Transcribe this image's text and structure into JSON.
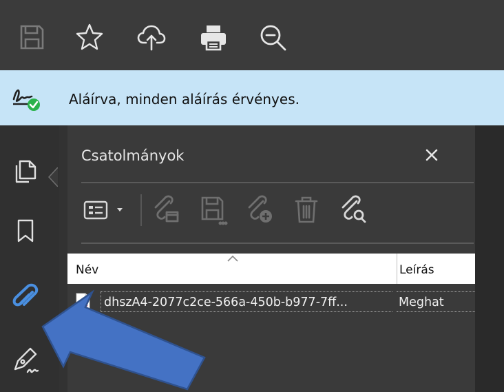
{
  "toolbar": {
    "icons": [
      "save-icon",
      "star-icon",
      "cloud-upload-icon",
      "print-icon",
      "zoom-out-icon"
    ],
    "background": "#3b3b3b"
  },
  "signature_banner": {
    "text": "Aláírva, minden aláírás érvényes.",
    "icon": "signature-valid-icon",
    "background": "#c6e4f7",
    "status_color": "#2bb24c"
  },
  "left_rail": {
    "icons": [
      "pages-icon",
      "bookmark-icon",
      "attachment-icon",
      "signature-pen-icon"
    ],
    "active": "attachment-icon",
    "accent": "#4a8fe0"
  },
  "attachments_panel": {
    "title": "Csatolmányok",
    "close_label": "✕",
    "tools": [
      "list-options-icon",
      "attach-file-icon",
      "save-attachment-icon",
      "add-attachment-icon",
      "delete-icon",
      "search-attachment-icon"
    ],
    "columns": [
      "Név",
      "Leírás"
    ],
    "rows": [
      {
        "name": "dhszA4-2077c2ce-566a-450b-b977-7ff...",
        "description": "Meghat",
        "icon": "pdf-file-icon"
      }
    ]
  },
  "annotation": {
    "arrow_color": "#4472c4",
    "arrow_outline": "#2f528f"
  }
}
